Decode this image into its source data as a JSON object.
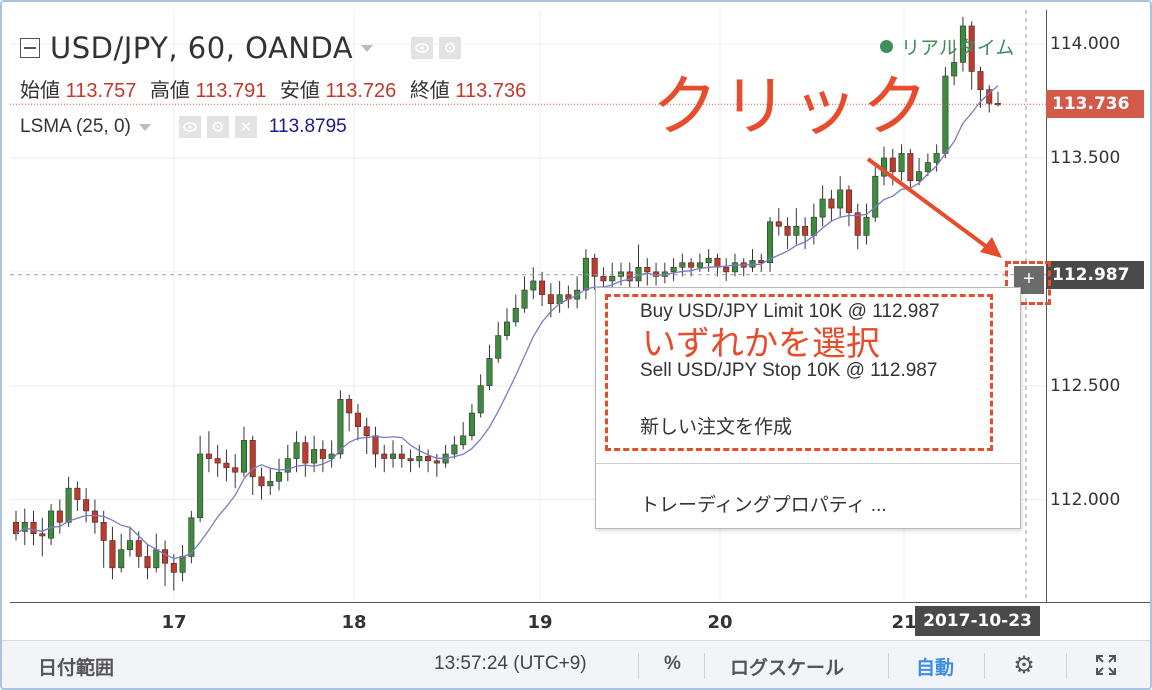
{
  "chart": {
    "symbol": "USD/JPY, 60, OANDA",
    "realtime_label": "リアルタイム",
    "ohlc": [
      {
        "label": "始値",
        "value": "113.757"
      },
      {
        "label": "高値",
        "value": "113.791"
      },
      {
        "label": "安値",
        "value": "113.726"
      },
      {
        "label": "終値",
        "value": "113.736"
      }
    ],
    "indicator": {
      "name": "LSMA (25, 0)",
      "value": "113.8795"
    },
    "price_axis": [
      "114.000",
      "113.500",
      "113.000",
      "112.500",
      "112.000"
    ],
    "last_price_tag": "113.736",
    "cursor_price_tag": "112.987",
    "date_axis": [
      "17",
      "18",
      "19",
      "20",
      "21"
    ],
    "cursor_date_tag": "2017-10-23",
    "plus_label": "+"
  },
  "annotations": {
    "click": "クリック",
    "select": "いずれかを選択"
  },
  "context_menu": {
    "items": [
      "Buy USD/JPY Limit 10K @ 112.987",
      "Sell USD/JPY Stop 10K @ 112.987",
      "新しい注文を作成",
      "トレーディングプロパティ ..."
    ]
  },
  "toolbar": {
    "date_range": "日付範囲",
    "time": "13:57:24 (UTC+9)",
    "percent": "%",
    "log_scale": "ログスケール",
    "auto": "自動"
  },
  "colors": {
    "up": "#3d8b3d",
    "down": "#c0392b",
    "ma": "#7b7bc4",
    "accent": "#e74c2c",
    "last_price": "#d35a4a",
    "cursor": "#4a4a4a"
  },
  "chart_data": {
    "type": "candlestick",
    "y_range": [
      111.55,
      114.15
    ],
    "last_price": 113.736,
    "cursor_price": 112.987,
    "candles": [
      [
        111.9,
        111.85,
        111.95,
        111.82
      ],
      [
        111.86,
        111.9,
        111.96,
        111.8
      ],
      [
        111.9,
        111.85,
        111.95,
        111.8
      ],
      [
        111.85,
        111.84,
        111.92,
        111.75
      ],
      [
        111.83,
        111.95,
        111.98,
        111.8
      ],
      [
        111.95,
        111.9,
        112.0,
        111.85
      ],
      [
        111.9,
        112.05,
        112.1,
        111.88
      ],
      [
        112.05,
        112.0,
        112.08,
        111.95
      ],
      [
        112.0,
        111.95,
        112.05,
        111.9
      ],
      [
        111.95,
        111.9,
        112.0,
        111.85
      ],
      [
        111.9,
        111.82,
        111.95,
        111.7
      ],
      [
        111.82,
        111.7,
        111.88,
        111.65
      ],
      [
        111.7,
        111.78,
        111.85,
        111.68
      ],
      [
        111.78,
        111.82,
        111.88,
        111.75
      ],
      [
        111.82,
        111.75,
        111.86,
        111.7
      ],
      [
        111.75,
        111.7,
        111.8,
        111.65
      ],
      [
        111.7,
        111.78,
        111.85,
        111.68
      ],
      [
        111.78,
        111.72,
        111.82,
        111.62
      ],
      [
        111.72,
        111.68,
        111.76,
        111.6
      ],
      [
        111.68,
        111.75,
        111.8,
        111.64
      ],
      [
        111.75,
        111.92,
        111.95,
        111.72
      ],
      [
        111.92,
        112.2,
        112.28,
        111.9
      ],
      [
        112.2,
        112.18,
        112.3,
        112.12
      ],
      [
        112.18,
        112.16,
        112.24,
        112.1
      ],
      [
        112.16,
        112.14,
        112.22,
        112.08
      ],
      [
        112.14,
        112.12,
        112.2,
        112.05
      ],
      [
        112.12,
        112.26,
        112.32,
        112.1
      ],
      [
        112.26,
        112.1,
        112.28,
        112.02
      ],
      [
        112.1,
        112.06,
        112.14,
        112.0
      ],
      [
        112.06,
        112.08,
        112.14,
        112.02
      ],
      [
        112.08,
        112.12,
        112.18,
        112.04
      ],
      [
        112.12,
        112.18,
        112.24,
        112.08
      ],
      [
        112.18,
        112.25,
        112.3,
        112.12
      ],
      [
        112.25,
        112.16,
        112.28,
        112.1
      ],
      [
        112.16,
        112.22,
        112.28,
        112.12
      ],
      [
        112.22,
        112.18,
        112.26,
        112.12
      ],
      [
        112.18,
        112.2,
        112.26,
        112.14
      ],
      [
        112.2,
        112.44,
        112.48,
        112.18
      ],
      [
        112.44,
        112.38,
        112.46,
        112.3
      ],
      [
        112.38,
        112.32,
        112.42,
        112.26
      ],
      [
        112.32,
        112.28,
        112.36,
        112.2
      ],
      [
        112.28,
        112.2,
        112.32,
        112.14
      ],
      [
        112.2,
        112.18,
        112.24,
        112.12
      ],
      [
        112.18,
        112.2,
        112.26,
        112.14
      ],
      [
        112.2,
        112.18,
        112.24,
        112.14
      ],
      [
        112.18,
        112.17,
        112.22,
        112.12
      ],
      [
        112.17,
        112.19,
        112.24,
        112.14
      ],
      [
        112.19,
        112.17,
        112.22,
        112.12
      ],
      [
        112.17,
        112.16,
        112.2,
        112.1
      ],
      [
        112.16,
        112.2,
        112.24,
        112.14
      ],
      [
        112.2,
        112.24,
        112.28,
        112.18
      ],
      [
        112.24,
        112.28,
        112.34,
        112.22
      ],
      [
        112.28,
        112.38,
        112.42,
        112.26
      ],
      [
        112.38,
        112.5,
        112.55,
        112.36
      ],
      [
        112.5,
        112.62,
        112.68,
        112.48
      ],
      [
        112.62,
        112.72,
        112.78,
        112.6
      ],
      [
        112.72,
        112.78,
        112.84,
        112.7
      ],
      [
        112.78,
        112.84,
        112.9,
        112.76
      ],
      [
        112.84,
        112.92,
        112.98,
        112.82
      ],
      [
        112.92,
        112.96,
        113.02,
        112.88
      ],
      [
        112.96,
        112.9,
        113.0,
        112.85
      ],
      [
        112.9,
        112.86,
        112.95,
        112.8
      ],
      [
        112.86,
        112.9,
        112.96,
        112.82
      ],
      [
        112.9,
        112.88,
        112.94,
        112.84
      ],
      [
        112.88,
        112.92,
        112.98,
        112.84
      ],
      [
        112.92,
        113.06,
        113.1,
        112.88
      ],
      [
        113.06,
        112.98,
        113.08,
        112.92
      ],
      [
        112.98,
        112.96,
        113.02,
        112.9
      ],
      [
        112.96,
        112.98,
        113.04,
        112.92
      ],
      [
        112.98,
        113.0,
        113.04,
        112.94
      ],
      [
        113.0,
        112.96,
        113.04,
        112.92
      ],
      [
        112.96,
        113.02,
        113.12,
        112.92
      ],
      [
        113.02,
        113.0,
        113.06,
        112.94
      ],
      [
        113.0,
        112.98,
        113.04,
        112.94
      ],
      [
        112.98,
        113.0,
        113.04,
        112.95
      ],
      [
        113.0,
        113.02,
        113.06,
        112.96
      ],
      [
        113.02,
        113.04,
        113.08,
        112.98
      ],
      [
        113.04,
        113.02,
        113.06,
        112.98
      ],
      [
        113.02,
        113.04,
        113.08,
        113.0
      ],
      [
        113.04,
        113.06,
        113.1,
        113.0
      ],
      [
        113.06,
        113.02,
        113.08,
        112.98
      ],
      [
        113.02,
        113.0,
        113.06,
        112.96
      ],
      [
        113.0,
        113.04,
        113.08,
        112.98
      ],
      [
        113.04,
        113.02,
        113.06,
        112.98
      ],
      [
        113.02,
        113.05,
        113.1,
        113.0
      ],
      [
        113.05,
        113.04,
        113.08,
        113.0
      ],
      [
        113.04,
        113.22,
        113.24,
        113.0
      ],
      [
        113.22,
        113.2,
        113.28,
        113.16
      ],
      [
        113.2,
        113.16,
        113.24,
        113.1
      ],
      [
        113.16,
        113.2,
        113.28,
        113.12
      ],
      [
        113.2,
        113.16,
        113.24,
        113.1
      ],
      [
        113.16,
        113.24,
        113.3,
        113.12
      ],
      [
        113.24,
        113.32,
        113.38,
        113.2
      ],
      [
        113.32,
        113.28,
        113.36,
        113.22
      ],
      [
        113.28,
        113.36,
        113.42,
        113.24
      ],
      [
        113.36,
        113.26,
        113.38,
        113.2
      ],
      [
        113.26,
        113.16,
        113.3,
        113.1
      ],
      [
        113.16,
        113.24,
        113.3,
        113.12
      ],
      [
        113.24,
        113.42,
        113.46,
        113.22
      ],
      [
        113.42,
        113.5,
        113.55,
        113.38
      ],
      [
        113.5,
        113.44,
        113.54,
        113.38
      ],
      [
        113.44,
        113.52,
        113.56,
        113.4
      ],
      [
        113.52,
        113.4,
        113.54,
        113.36
      ],
      [
        113.4,
        113.44,
        113.5,
        113.38
      ],
      [
        113.44,
        113.48,
        113.52,
        113.42
      ],
      [
        113.48,
        113.52,
        113.56,
        113.44
      ],
      [
        113.52,
        113.86,
        113.9,
        113.5
      ],
      [
        113.86,
        113.92,
        114.02,
        113.82
      ],
      [
        113.92,
        114.08,
        114.12,
        113.88
      ],
      [
        114.08,
        113.88,
        114.1,
        113.8
      ],
      [
        113.88,
        113.8,
        113.9,
        113.72
      ],
      [
        113.8,
        113.74,
        113.82,
        113.7
      ],
      [
        113.74,
        113.736,
        113.791,
        113.726
      ]
    ]
  }
}
